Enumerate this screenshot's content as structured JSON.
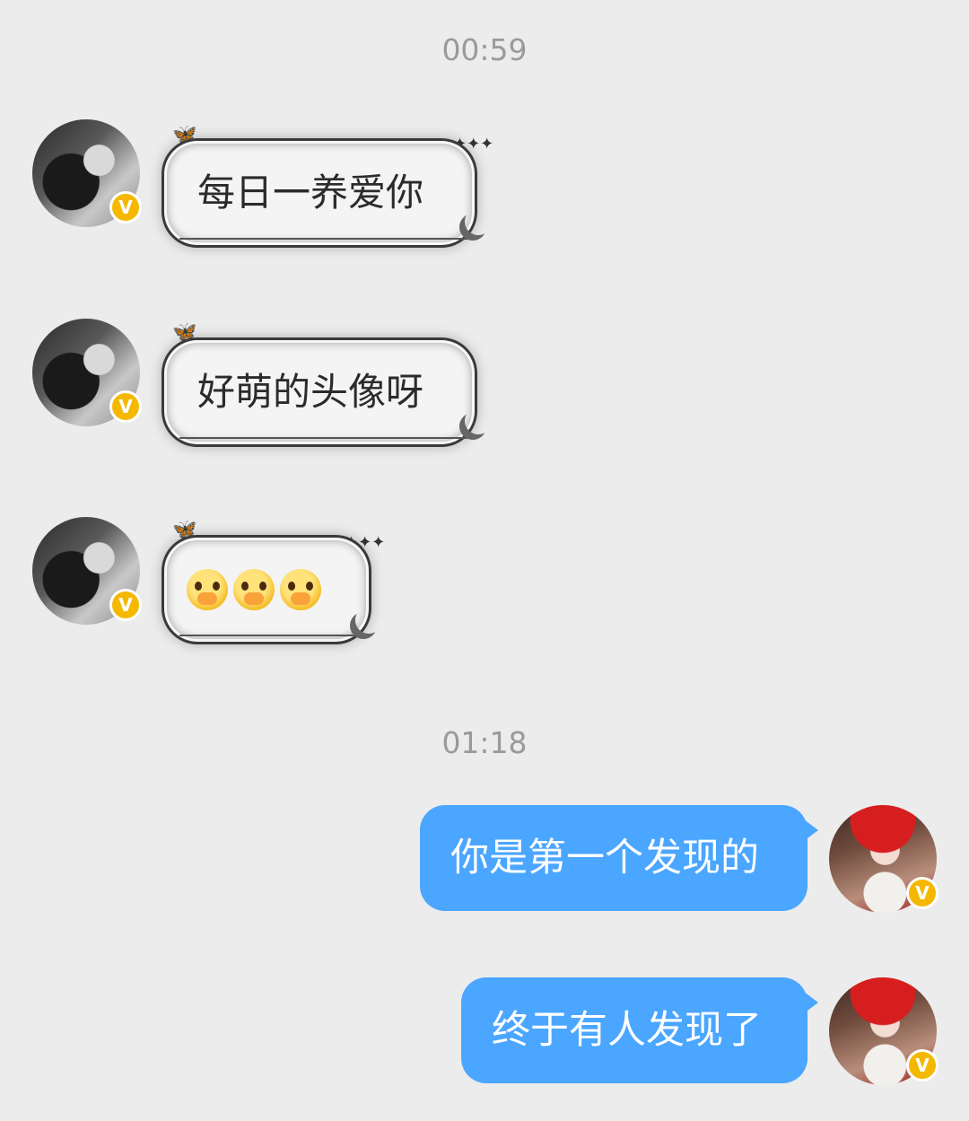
{
  "timestamps": {
    "first": "00:59",
    "second": "01:18"
  },
  "messages": [
    {
      "side": "left",
      "text": "每日一养爱你"
    },
    {
      "side": "left",
      "text": "好萌的头像呀"
    },
    {
      "side": "left",
      "text": "",
      "emoji": [
        "crying-face-covering-mouth-emoji",
        "crying-face-covering-mouth-emoji",
        "crying-face-covering-mouth-emoji"
      ]
    },
    {
      "side": "right",
      "text": "你是第一个发现的"
    },
    {
      "side": "right",
      "text": "终于有人发现了"
    }
  ],
  "badges": {
    "verified": "V"
  },
  "colors": {
    "background": "#ececec",
    "outgoing_bubble": "#4aa6ff",
    "incoming_bubble": "#f4f4f4",
    "verified_badge": "#f5b800",
    "timestamp_text": "#9a9a9a"
  }
}
